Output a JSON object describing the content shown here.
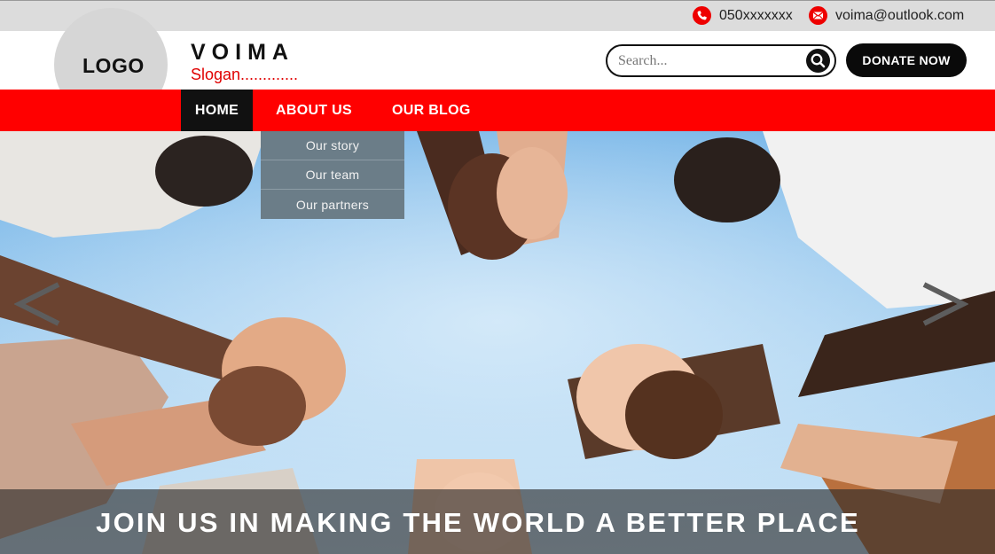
{
  "topbar": {
    "phone": "050xxxxxxx",
    "email": "voima@outlook.com",
    "phone_icon": "phone-icon",
    "email_icon": "mail-icon"
  },
  "header": {
    "logo": "LOGO",
    "brand": "VOIMA",
    "slogan": "Slogan.............",
    "search_placeholder": "Search...",
    "search_icon": "search-icon",
    "donate_label": "DONATE NOW"
  },
  "nav": {
    "items": [
      {
        "label": "HOME",
        "active": true
      },
      {
        "label": "ABOUT US",
        "active": false
      },
      {
        "label": "OUR BLOG",
        "active": false
      }
    ],
    "dropdown": [
      "Our story",
      "Our team",
      "Our partners"
    ]
  },
  "hero": {
    "caption": "JOIN US IN MAKING THE WORLD A BETTER PLACE",
    "prev_icon": "chevron-left-icon",
    "next_icon": "chevron-right-icon"
  },
  "colors": {
    "accent": "#ff0000",
    "dark": "#111111",
    "topbar": "#dcdcdc",
    "dropdown": "#6b7d88",
    "sky": "#8fc3ea"
  }
}
